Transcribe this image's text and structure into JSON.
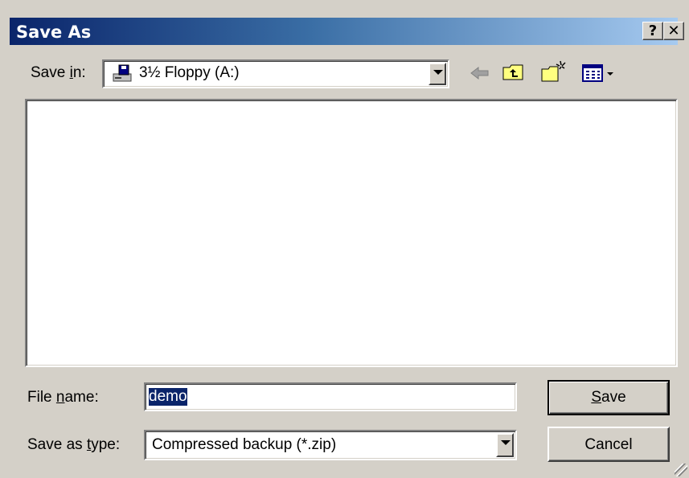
{
  "window": {
    "title": "Save As",
    "help_label": "?",
    "close_label": "✕"
  },
  "toolbar": {
    "save_in_prefix": "Save ",
    "save_in_accel": "i",
    "save_in_suffix": "n:",
    "location": "3½ Floppy (A:)",
    "icons": [
      "floppy-drive-icon",
      "back-arrow-icon",
      "up-one-level-icon",
      "new-folder-icon",
      "view-menu-icon"
    ]
  },
  "form": {
    "file_name_prefix": "File ",
    "file_name_accel": "n",
    "file_name_suffix": "ame:",
    "file_name_value": "demo",
    "save_as_type_prefix": "Save as ",
    "save_as_type_accel": "t",
    "save_as_type_suffix": "ype:",
    "save_as_type_value": "Compressed backup (*.zip)"
  },
  "buttons": {
    "save_accel": "S",
    "save_rest": "ave",
    "cancel_label": "Cancel"
  },
  "colors": {
    "face": "#d4d0c8",
    "title_start": "#0a246a",
    "title_end": "#a6caf0",
    "selection": "#0a246a"
  }
}
